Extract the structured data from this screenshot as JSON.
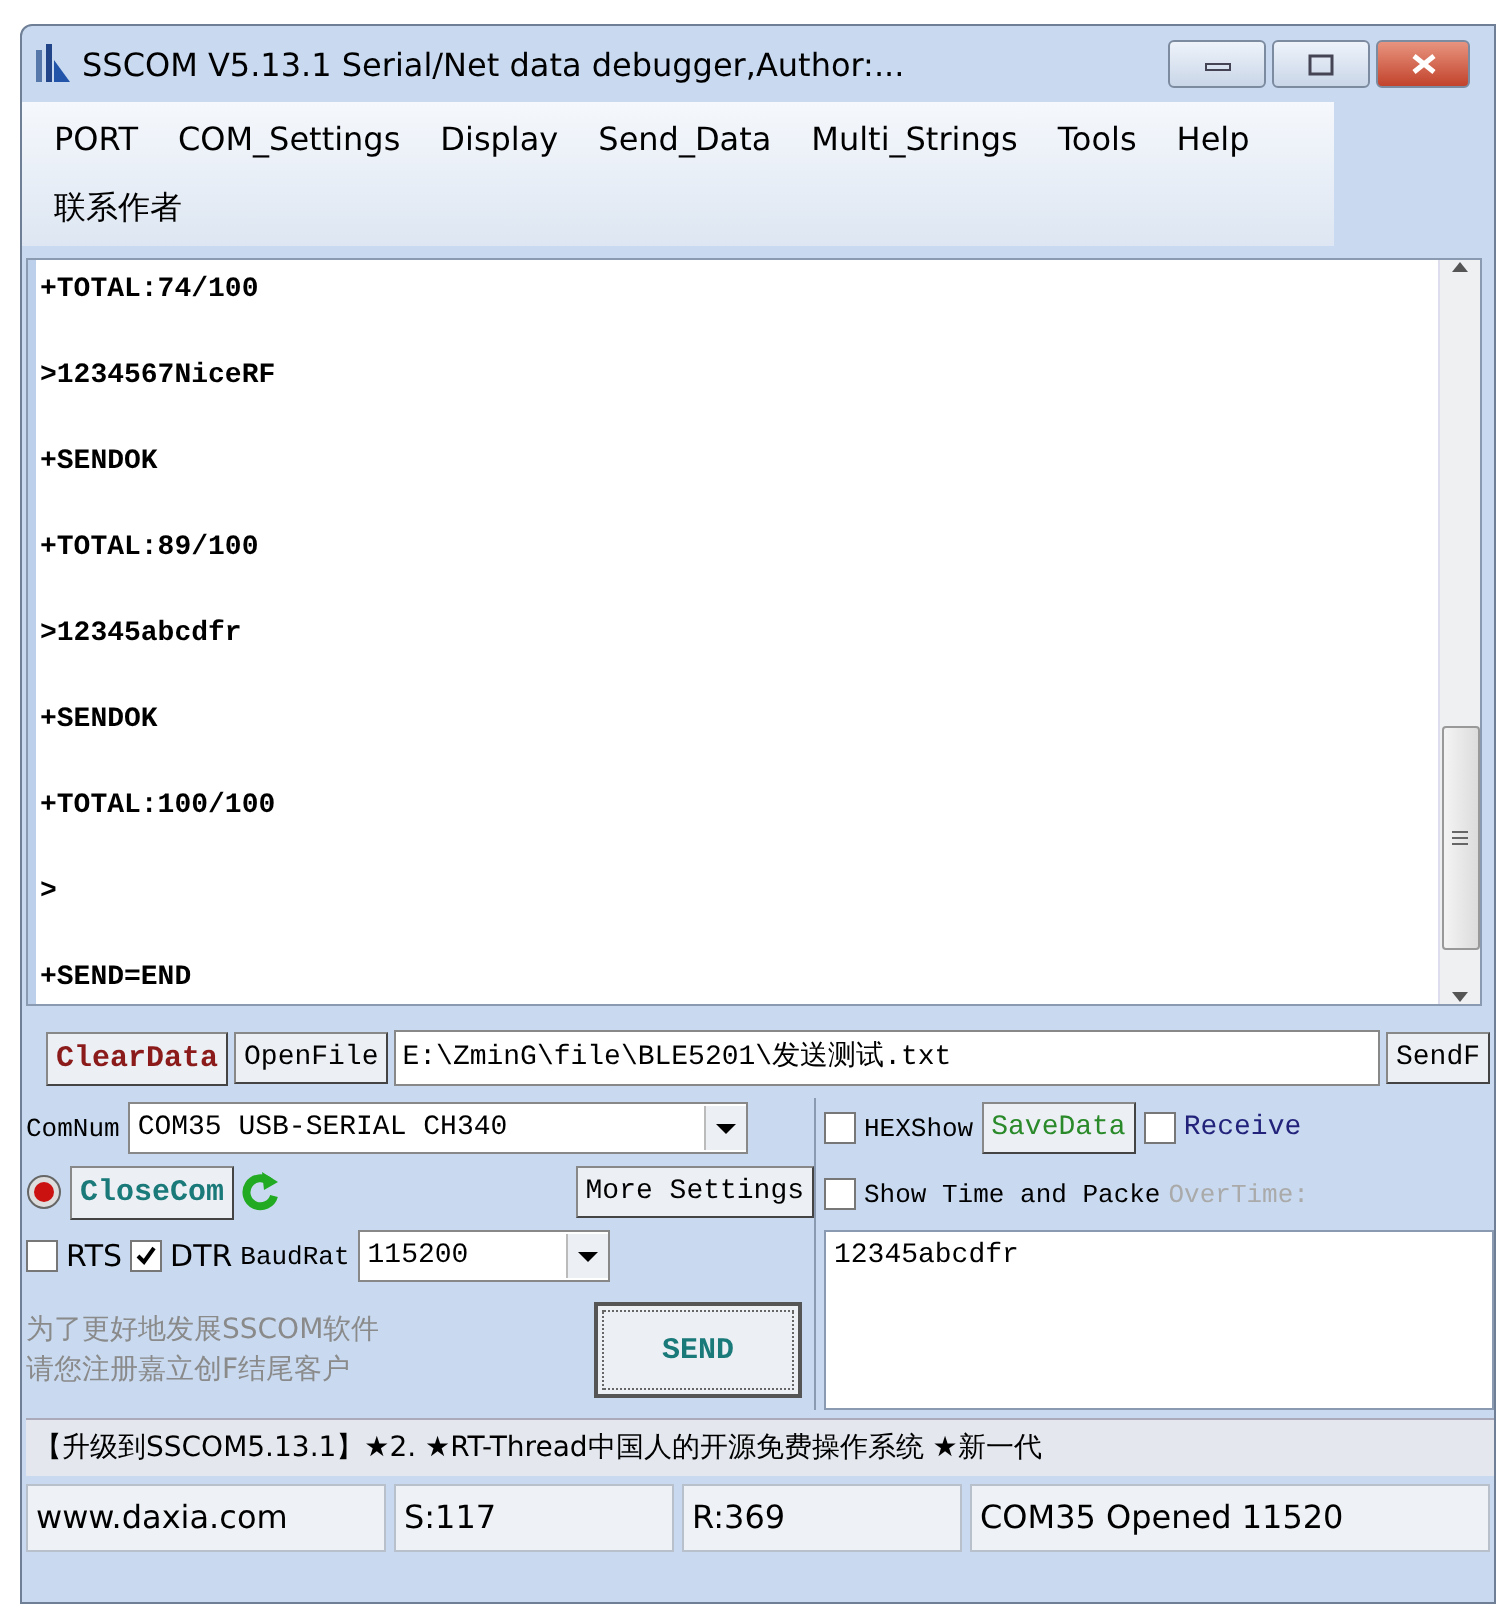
{
  "window": {
    "title": "SSCOM V5.13.1 Serial/Net data debugger,Author:..."
  },
  "menu": [
    {
      "label": "PORT"
    },
    {
      "label": "COM_Settings"
    },
    {
      "label": "Display"
    },
    {
      "label": "Send_Data"
    },
    {
      "label": "Multi_Strings"
    },
    {
      "label": "Tools"
    },
    {
      "label": "Help"
    },
    {
      "label": "联系作者"
    }
  ],
  "output": {
    "lines": [
      {
        "text": "+TOTAL:74/100"
      },
      {
        "text": ">1234567NiceRF"
      },
      {
        "text": "+SENDOK"
      },
      {
        "text": "+TOTAL:89/100"
      },
      {
        "text": ">12345abcdfr"
      },
      {
        "text": "+SENDOK"
      },
      {
        "text": "+TOTAL:100/100"
      },
      {
        "text": ">"
      },
      {
        "text": "+SEND=END"
      }
    ]
  },
  "file_row": {
    "clear_button": "ClearData",
    "open_button": "OpenFile",
    "path": "E:\\ZminG\\file\\BLE5201\\发送测试.txt",
    "send_file_button": "SendF"
  },
  "port": {
    "label": "ComNum",
    "value": "COM35 USB-SERIAL CH340",
    "close_button": "CloseCom",
    "more_button": "More Settings",
    "baud_label": "BaudRat",
    "baud_value": "115200"
  },
  "line_controls": [
    {
      "label": "RTS",
      "checked": false
    },
    {
      "label": "DTR",
      "checked": true
    }
  ],
  "promo": [
    "为了更好地发展SSCOM软件",
    "请您注册嘉立创F结尾客户"
  ],
  "send_button": "SEND",
  "options": [
    {
      "kind": "checkbox",
      "label": "HEXShow",
      "checked": false
    },
    {
      "kind": "button",
      "label": "SaveData"
    },
    {
      "kind": "checkbox",
      "label": "Receive",
      "checked": false
    }
  ],
  "options2": [
    {
      "kind": "checkbox",
      "label": "Show Time and Packe",
      "checked": false
    },
    {
      "kind": "label",
      "label": "OverTime:"
    }
  ],
  "send_text": "12345abcdfr",
  "ticker": "【升级到SSCOM5.13.1】★2. ★RT-Thread中国人的开源免费操作系统 ★新一代",
  "status_bar": [
    "www.daxia.com",
    "S:117",
    "R:369",
    "COM35 Opened  11520"
  ]
}
